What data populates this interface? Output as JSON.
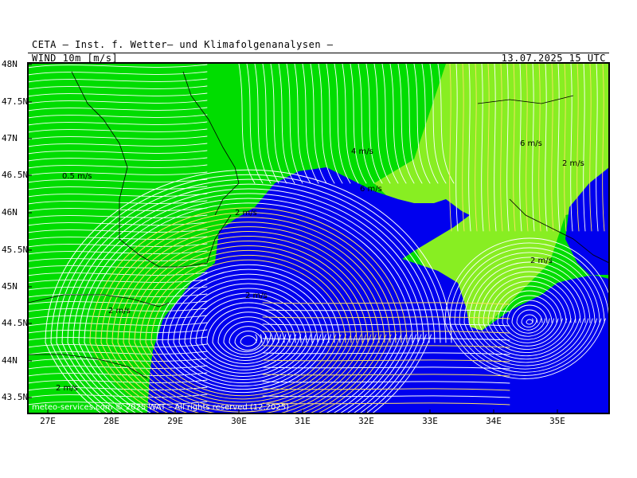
{
  "header": {
    "title": "CETA – Inst. f. Wetter– und Klimafolgenanalysen –",
    "variable": "WIND 10m [m/s]",
    "valid_time": "13.07.2025 15 UTC"
  },
  "axes": {
    "lat_labels": [
      "48N",
      "47.5N",
      "47N",
      "46.5N",
      "46N",
      "45.5N",
      "45N",
      "44.5N",
      "44N",
      "43.5N"
    ],
    "lon_labels": [
      "27E",
      "28E",
      "29E",
      "30E",
      "31E",
      "32E",
      "33E",
      "34E",
      "35E"
    ]
  },
  "speed_labels": [
    {
      "text": "0.5 m/s"
    },
    {
      "text": "4 m/s"
    },
    {
      "text": "6 m/s"
    },
    {
      "text": "6 m/s"
    },
    {
      "text": "2 m/s"
    },
    {
      "text": "2 m/s"
    },
    {
      "text": "2 m/s"
    },
    {
      "text": "2 m/s"
    },
    {
      "text": "2 m/s"
    },
    {
      "text": "2 m/s"
    }
  ],
  "footer": "meteo-services.com  © 2025 WAT – All rights reserved (12.2025)",
  "colors": {
    "land": "#00dd00",
    "land_fast": "#88ee22",
    "sea": "#0000ee",
    "streamline": "#ffffff",
    "streamline_fast": "#ffe066",
    "border": "#000000"
  }
}
